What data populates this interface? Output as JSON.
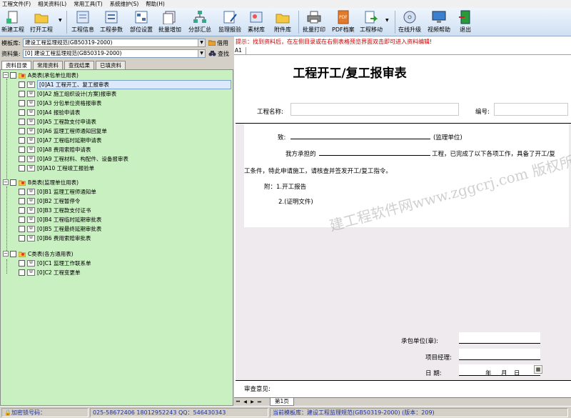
{
  "menu": [
    "工程文件(F)",
    "相关资料(L)",
    "常用工具(T)",
    "系统维护(S)",
    "帮助(H)"
  ],
  "toolbar": {
    "new_project": "新建工程",
    "open_project": "打开工程",
    "project_info": "工程信息",
    "project_params": "工程参数",
    "dept_settings": "部位设置",
    "batch_add": "批量增加",
    "section_summary": "分部汇总",
    "supervision_log": "监理报验",
    "material_lib": "素材库",
    "attachment_lib": "附件库",
    "batch_print": "批量打印",
    "pdf_archive": "PDF档案",
    "project_move": "工程移动",
    "online_upgrade": "在线升级",
    "video_help": "视频帮助",
    "exit": "退出"
  },
  "left": {
    "template_label": "模板库:",
    "template_value": "建设工程监理规范(GB50319-2000)",
    "borrow_label": "借用",
    "dataset_label": "资料集:",
    "dataset_value": "[0] 建设工程监理规范(GB50319-2000)",
    "search_label": "查找",
    "tabs": [
      "资料目录",
      "常用资料",
      "查找结果",
      "已填资料"
    ],
    "tree": {
      "groupA": "A类表(承包单位用表)",
      "itemsA": [
        "[0]A1 工程开工、复工报审表",
        "[0]A2 施工组织设计(方案)报审表",
        "[0]A3 分包单位资格报审表",
        "[0]A4 报验申请表",
        "[0]A5 工程款支付申请表",
        "[0]A6 监理工程师通知回复单",
        "[0]A7 工程临时延期申请表",
        "[0]A8 费用索赔申请表",
        "[0]A9 工程材料、构配件、设备报审表",
        "[0]A10 工程竣工报验单"
      ],
      "groupB": "B类表(监理单位用表)",
      "itemsB": [
        "[0]B1 监理工程师通知单",
        "[0]B2 工程暂停令",
        "[0]B3 工程款支付证书",
        "[0]B4 工程临时延期审批表",
        "[0]B5 工程最终延期审批表",
        "[0]B6 费用索赔审批表"
      ],
      "groupC": "C类表(各方通用表)",
      "itemsC": [
        "[0]C1 监理工作联系单",
        "[0]C2 工程变更单"
      ],
      "doc_icon": "W"
    }
  },
  "right": {
    "hint": "提示：找到资料后，在左侧目录或在右侧表格预览界面双击即可进入资料编辑!",
    "cell_ref": "A1",
    "form": {
      "title": "工程开工/复工报审表",
      "project_name_label": "工程名称:",
      "number_label": "编号:",
      "to_label": "致:",
      "supervisor_unit": "(监理单位)",
      "line1_prefix": "我方承担的",
      "line1_suffix": "工程，已完成了以下各项工作，具备了开工/复",
      "line2": "工条件，特此申请施工，请核查并签发开工/复工指令。",
      "attach_label": "附：1.开工报告",
      "attach_2": "2.(证明文件)",
      "contractor_label": "承包单位(章):",
      "manager_label": "项目经理:",
      "date_label": "日    期:",
      "year": "年",
      "month": "月",
      "day": "日",
      "review_label": "审查意见:"
    },
    "watermark": "建工程软件网www.zggcrj.com 版权所有违者必究",
    "sheet_tab": "第1页"
  },
  "status": {
    "lock_label": "加密锁号码：",
    "phone": "025-58672406 18012952243  QQ：546430343",
    "current_template": "当前模板库：建设工程监理规范(GB50319-2000)  (版本：209)"
  }
}
